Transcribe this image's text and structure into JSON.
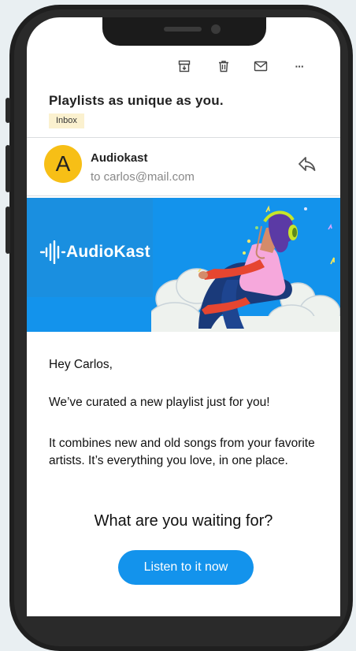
{
  "email": {
    "subject": "Playlists as unique as you.",
    "label": "Inbox",
    "sender": {
      "avatar_letter": "A",
      "name": "Audiokast",
      "to": "to carlos@mail.com"
    }
  },
  "toolbar": {
    "icons": [
      "archive-icon",
      "trash-icon",
      "mail-icon",
      "more-icon"
    ],
    "more_glyph": "···"
  },
  "banner": {
    "brand": "AudioKast"
  },
  "message": {
    "greeting": "Hey Carlos,",
    "line1": "We’ve curated a new playlist just for you!",
    "line2": "It combines new and old songs from your favorite artists. It’s everything you love, in one place.",
    "question": "What are you waiting for?",
    "cta": "Listen to it now"
  },
  "colors": {
    "accent": "#1393ec",
    "avatar": "#f7bf16",
    "badge": "#fbf1cf"
  }
}
